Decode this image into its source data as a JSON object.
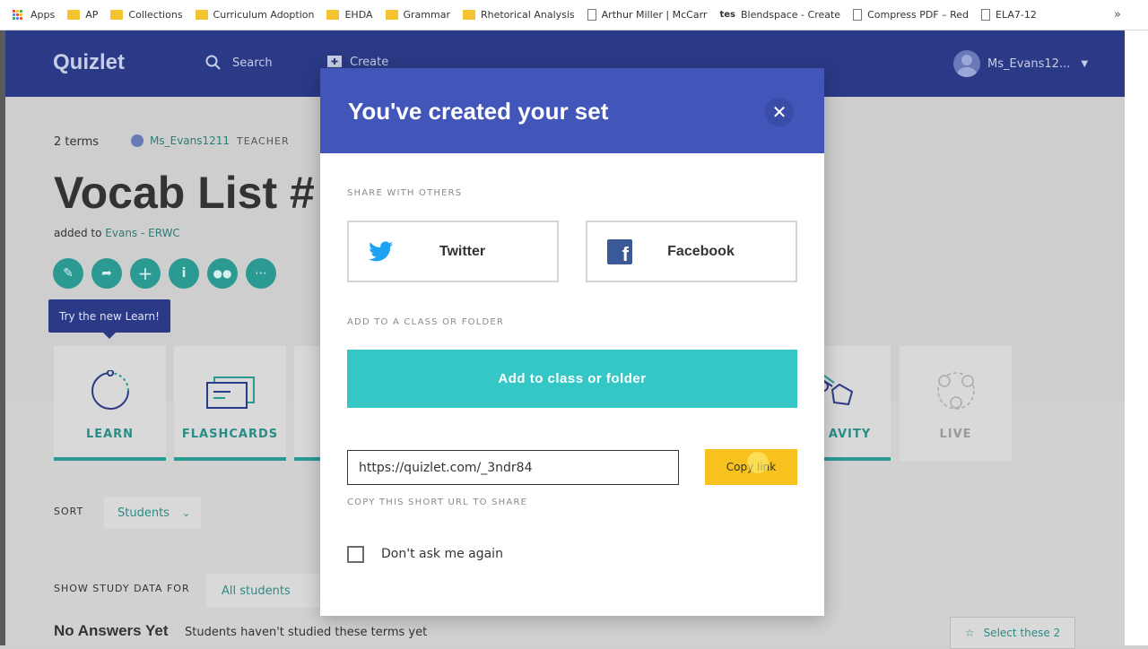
{
  "bookmarks": [
    {
      "label": "Apps",
      "icon": "apps-grid-icon"
    },
    {
      "label": "AP",
      "icon": "folder-icon"
    },
    {
      "label": "Collections",
      "icon": "folder-icon"
    },
    {
      "label": "Curriculum Adoption",
      "icon": "folder-icon"
    },
    {
      "label": "EHDA",
      "icon": "folder-icon"
    },
    {
      "label": "Grammar",
      "icon": "folder-icon"
    },
    {
      "label": "Rhetorical Analysis",
      "icon": "folder-icon"
    },
    {
      "label": "Arthur Miller | McCarr",
      "icon": "page-icon"
    },
    {
      "label": "Blendspace - Create",
      "icon": "tes-icon"
    },
    {
      "label": "Compress PDF – Red",
      "icon": "page-icon"
    },
    {
      "label": "ELA7-12",
      "icon": "page-icon"
    }
  ],
  "bookmarks_more": "»",
  "header": {
    "logo": "Quizlet",
    "search_label": "Search",
    "create_label": "Create",
    "username": "Ms_Evans12..."
  },
  "set": {
    "terms": "2 terms",
    "author": "Ms_Evans1211",
    "role": "TEACHER",
    "title": "Vocab List #",
    "added_prefix": "added to",
    "added_class": "Evans - ERWC",
    "tooltip": "Try the new Learn!"
  },
  "modes": {
    "learn": "LEARN",
    "flashcards": "FLASHCARDS",
    "gravity": "AVITY",
    "live": "LIVE"
  },
  "sort": {
    "label": "SORT",
    "value": "Students"
  },
  "study": {
    "label": "SHOW STUDY DATA FOR",
    "value": "All students",
    "no_answers": "No Answers Yet",
    "no_answers_sub": "Students haven't studied these terms yet",
    "select_these": "Select these 2"
  },
  "modal": {
    "title": "You've created your set",
    "share_label": "SHARE WITH OTHERS",
    "twitter": "Twitter",
    "facebook": "Facebook",
    "add_label": "ADD TO A CLASS OR FOLDER",
    "add_button": "Add to class or folder",
    "url": "https://quizlet.com/_3ndr84",
    "copy_button": "Copy link",
    "copy_hint": "COPY THIS SHORT URL TO SHARE",
    "dont_ask": "Don't ask me again"
  },
  "colors": {
    "header": "#2b3a86",
    "modal_header": "#4255b9",
    "teal": "#35c6c6",
    "copy_yellow": "#f7c21e"
  }
}
